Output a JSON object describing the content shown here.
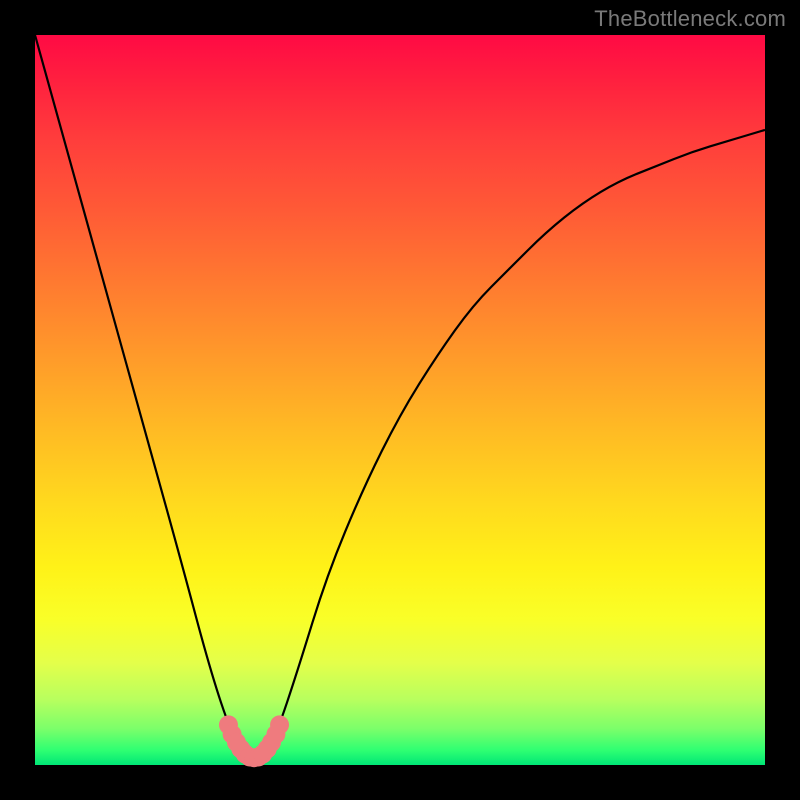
{
  "watermark": "TheBottleneck.com",
  "chart_data": {
    "type": "line",
    "title": "",
    "xlabel": "",
    "ylabel": "",
    "xlim": [
      0,
      100
    ],
    "ylim": [
      0,
      100
    ],
    "series": [
      {
        "name": "bottleneck-curve",
        "x": [
          0,
          5,
          10,
          15,
          20,
          24,
          27,
          29,
          30,
          31,
          33,
          36,
          40,
          45,
          50,
          55,
          60,
          65,
          70,
          75,
          80,
          85,
          90,
          95,
          100
        ],
        "y": [
          100,
          82,
          64,
          46,
          28,
          13,
          4,
          1,
          0,
          1,
          4,
          13,
          26,
          38,
          48,
          56,
          63,
          68,
          73,
          77,
          80,
          82,
          84,
          85.5,
          87
        ]
      },
      {
        "name": "valley-marker",
        "x": [
          26.5,
          27.0,
          27.6,
          28.2,
          28.8,
          29.4,
          30.0,
          30.6,
          31.2,
          31.8,
          32.4,
          33.0,
          33.5
        ],
        "y": [
          5.5,
          4.2,
          3.1,
          2.2,
          1.5,
          1.1,
          1.0,
          1.1,
          1.5,
          2.2,
          3.1,
          4.2,
          5.5
        ]
      }
    ],
    "annotations": []
  },
  "colors": {
    "curve": "#000000",
    "marker": "#ef7b7e",
    "background_top": "#ff0a44",
    "background_bottom": "#00e676",
    "frame": "#000000"
  }
}
